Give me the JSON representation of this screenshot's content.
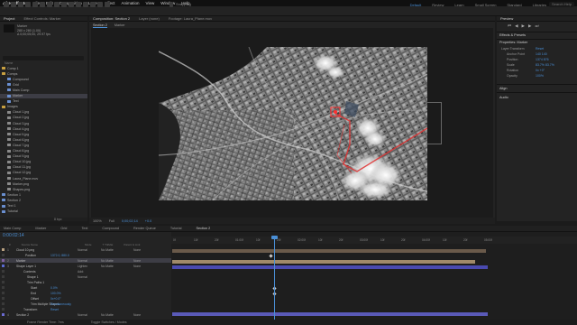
{
  "menubar": {
    "app": "After Effects",
    "items": [
      "File",
      "Edit",
      "Composition",
      "Layer",
      "Effect",
      "Animation",
      "View",
      "Window",
      "Help"
    ],
    "right": [
      "Sat 10:03"
    ]
  },
  "toolbar": {
    "snapping": "Snapping",
    "workspaces": [
      "Default",
      "Review",
      "Learn",
      "Small Screen",
      "Standard",
      "Libraries"
    ],
    "active_workspace": "Default",
    "search_placeholder": "Search Help"
  },
  "project": {
    "tabs": [
      "Project",
      "Effect Controls: Marker"
    ],
    "info": [
      "Marker",
      "280 x 280 (1.00)",
      "Δ 0;00;05;00, 29.97 fps"
    ],
    "items": [
      {
        "name": "Comp 1",
        "type": "folder"
      },
      {
        "name": "Comps",
        "type": "folder"
      },
      {
        "name": "Compound",
        "type": "comp"
      },
      {
        "name": "Grid",
        "type": "comp"
      },
      {
        "name": "Main Comp",
        "type": "comp"
      },
      {
        "name": "Marker",
        "type": "comp"
      },
      {
        "name": "Text",
        "type": "comp"
      },
      {
        "name": "Images",
        "type": "folder"
      },
      {
        "name": "Cloud 1.jpg",
        "type": "img"
      },
      {
        "name": "Cloud 2.jpg",
        "type": "img"
      },
      {
        "name": "Cloud 3.jpg",
        "type": "img"
      },
      {
        "name": "Cloud 4.jpg",
        "type": "img"
      },
      {
        "name": "Cloud 5.jpg",
        "type": "img"
      },
      {
        "name": "Cloud 6.jpg",
        "type": "img"
      },
      {
        "name": "Cloud 7.jpg",
        "type": "img"
      },
      {
        "name": "Cloud 8.jpg",
        "type": "img"
      },
      {
        "name": "Cloud 9.jpg",
        "type": "img"
      },
      {
        "name": "Cloud 10.jpg",
        "type": "img"
      },
      {
        "name": "Cloud 11.jpg",
        "type": "img"
      },
      {
        "name": "Cloud 12.jpg",
        "type": "img"
      },
      {
        "name": "Laura_Plane.mov",
        "type": "img"
      },
      {
        "name": "Marker.png",
        "type": "img"
      },
      {
        "name": "Shapes.png",
        "type": "img"
      },
      {
        "name": "Section 1",
        "type": "comp"
      },
      {
        "name": "Section 2",
        "type": "comp"
      },
      {
        "name": "Text 1",
        "type": "comp"
      },
      {
        "name": "Tutorial",
        "type": "comp"
      }
    ],
    "selected_index": 5,
    "bpc": "8 bpc"
  },
  "composition": {
    "tabs": [
      "Composition: Section 2",
      "Layer (none)",
      "Footage: Laura_Plane.mov"
    ],
    "subtabs": [
      "Section 2",
      "Marker"
    ],
    "zoom": "100%",
    "resolution": "Full",
    "timecode": "0;00;02;14",
    "exposure": "+0.0"
  },
  "right": {
    "preview": "Preview",
    "effects_presets": "Effects & Presets",
    "properties_title": "Properties: Marker",
    "layer_transform": "Layer Transform",
    "reset": "Reset",
    "props": [
      {
        "label": "Anchor Point",
        "value": "140   140"
      },
      {
        "label": "Position",
        "value": "1374   876"
      },
      {
        "label": "Scale",
        "value": "83.7%   83.7%"
      },
      {
        "label": "Rotation",
        "value": "0x +0°"
      },
      {
        "label": "Opacity",
        "value": "100%"
      }
    ],
    "align": "Align",
    "audio": "Audio"
  },
  "timeline": {
    "tabs": [
      "Main Comp",
      "Marker",
      "Grid",
      "Text",
      "Compound",
      "Render Queue",
      "Tutorial",
      "Section 2"
    ],
    "active_tab": "Section 2",
    "timecode": "0:00:02:14",
    "col_headers": [
      "#",
      "Source Name",
      "Mode",
      "T TrkMat",
      "Parent & Link"
    ],
    "rows": [
      {
        "num": "1",
        "name": "Cloud 10.png",
        "mode": "Normal",
        "trk": "No Matte",
        "parent": "None"
      },
      {
        "num": "",
        "name": "Position",
        "value": "1372.0, 880.0",
        "mode": "",
        "trk": "",
        "parent": ""
      },
      {
        "num": "2",
        "name": "Marker",
        "mode": "Normal",
        "trk": "No Matte",
        "parent": "None"
      },
      {
        "num": "3",
        "name": "Shape Layer 1",
        "mode": "Lighten",
        "trk": "No Matte",
        "parent": "None"
      },
      {
        "num": "",
        "name": "Contents",
        "value": "",
        "mode": "Add:",
        "trk": "",
        "parent": ""
      },
      {
        "num": "",
        "name": "Shape 1",
        "mode": "Normal",
        "trk": "",
        "parent": ""
      },
      {
        "num": "",
        "name": "Trim Paths 1",
        "value": "",
        "mode": "",
        "trk": "",
        "parent": ""
      },
      {
        "num": "",
        "name": "Start",
        "value": "0.0%",
        "mode": "",
        "trk": "",
        "parent": ""
      },
      {
        "num": "",
        "name": "End",
        "value": "100.0%",
        "mode": "",
        "trk": "",
        "parent": ""
      },
      {
        "num": "",
        "name": "Offset",
        "value": "0x+0.0°",
        "mode": "",
        "trk": "",
        "parent": ""
      },
      {
        "num": "",
        "name": "Trim Multiple Shapes",
        "value": "Simultaneously",
        "mode": "",
        "trk": "",
        "parent": ""
      },
      {
        "num": "",
        "name": "Transform",
        "value": "Reset",
        "mode": "",
        "trk": "",
        "parent": ""
      },
      {
        "num": "4",
        "name": "Section 2",
        "mode": "Normal",
        "trk": "No Matte",
        "parent": "None"
      }
    ],
    "ruler": [
      "0f",
      "10f",
      "20f",
      "01:00f",
      "10f",
      "20f",
      "02:00f",
      "10f",
      "20f",
      "03:00f",
      "10f",
      "20f",
      "04:00f",
      "10f",
      "20f",
      "05:00f"
    ]
  },
  "status": {
    "frame_render": "Frame Render Time: 7ms",
    "toggle": "Toggle Switches / Modes"
  }
}
